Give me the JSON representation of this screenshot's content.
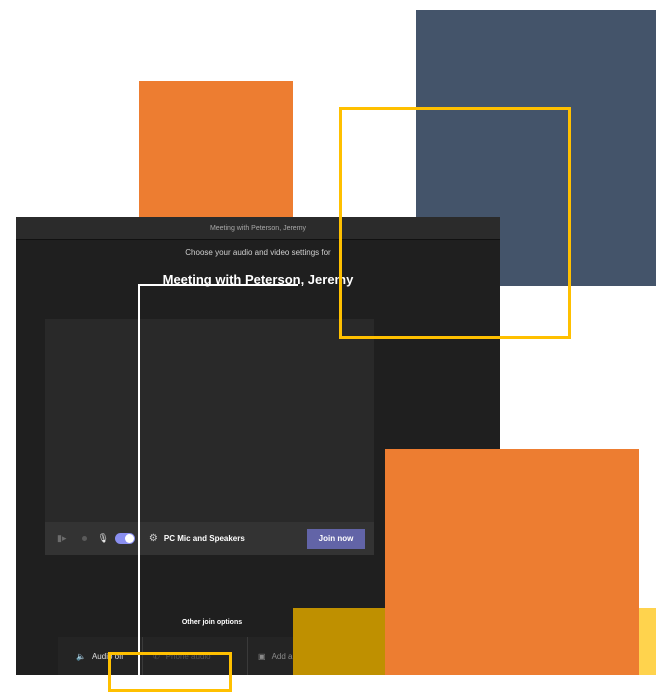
{
  "window": {
    "title": "Meeting with Peterson, Jeremy"
  },
  "prejoin": {
    "subtitle": "Choose your audio and video settings for",
    "meeting_title": "Meeting with Peterson, Jeremy",
    "audio_device_label": "PC Mic and Speakers",
    "join_button": "Join now",
    "camera_on": false,
    "mic_on": true
  },
  "other_options": {
    "heading": "Other join options",
    "items": [
      {
        "label": "Audio off",
        "icon": "speaker-muted-icon"
      },
      {
        "label": "Phone audio",
        "icon": "phone-icon"
      },
      {
        "label": "Add a room",
        "icon": "cast-icon"
      }
    ]
  },
  "decor_colors": {
    "orange": "#ED7D31",
    "slate": "#44546A",
    "gold": "#BF9000",
    "yellow": "#FFC000",
    "teams_purple": "#6264A7"
  }
}
